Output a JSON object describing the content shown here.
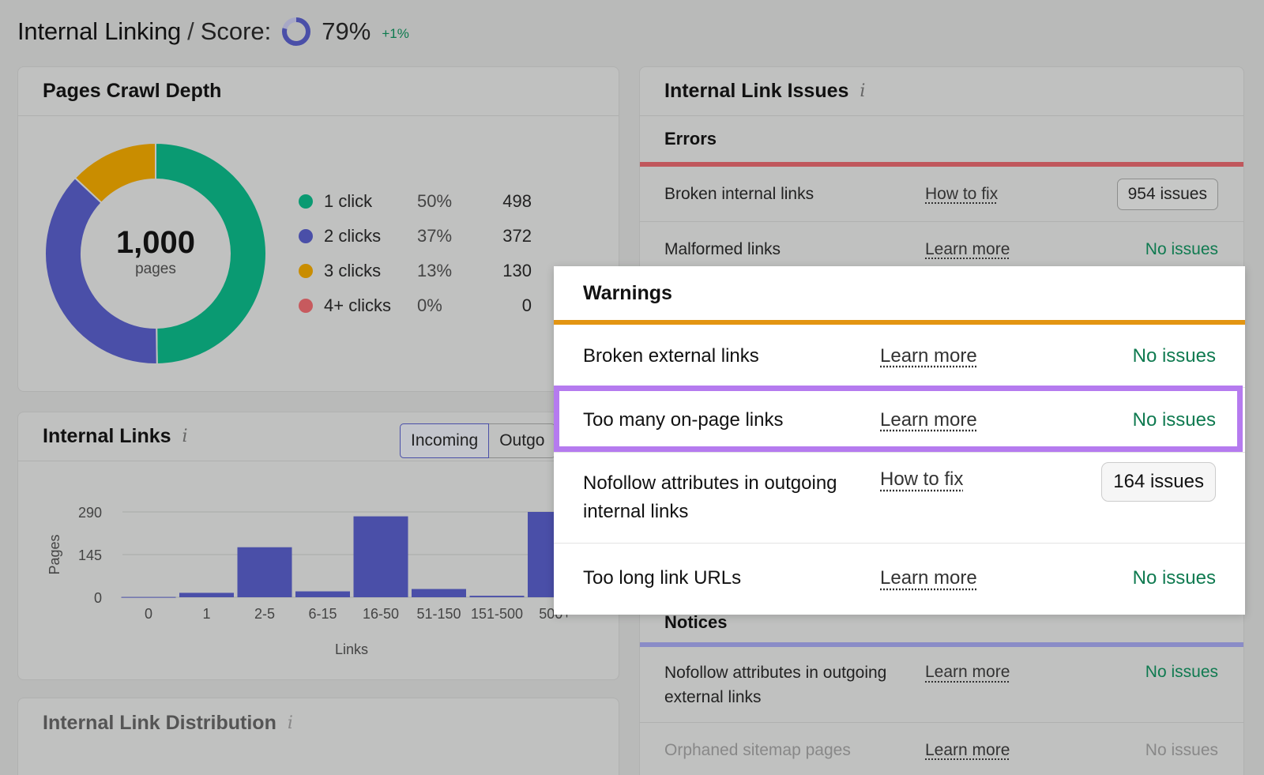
{
  "header": {
    "title": "Internal Linking",
    "separator": "/",
    "score_label": "Score:",
    "score_value": "79%",
    "score_delta": "+1%",
    "score_color": "#4a4fa8"
  },
  "crawl_depth": {
    "title": "Pages Crawl Depth",
    "total": "1,000",
    "total_label": "pages",
    "items": [
      {
        "label": "1 click",
        "pct": "50%",
        "value": "498",
        "color": "#0a9a72"
      },
      {
        "label": "2 clicks",
        "pct": "37%",
        "value": "372",
        "color": "#4a4fa8"
      },
      {
        "label": "3 clicks",
        "pct": "13%",
        "value": "130",
        "color": "#c98d00"
      },
      {
        "label": "4+ clicks",
        "pct": "0%",
        "value": "0",
        "color": "#c75a5e"
      }
    ]
  },
  "internal_links": {
    "title": "Internal Links",
    "tabs": [
      "Incoming",
      "Outgo"
    ]
  },
  "chart_data": {
    "type": "bar",
    "categories": [
      "0",
      "1",
      "2-5",
      "6-15",
      "16-50",
      "51-150",
      "151-500",
      "500+"
    ],
    "values": [
      1,
      15,
      170,
      20,
      275,
      28,
      5,
      290
    ],
    "xlabel": "Links",
    "ylabel": "Pages",
    "yticks": [
      "290",
      "145",
      "0"
    ],
    "ylim": [
      0,
      290
    ],
    "bar_color": "#4a4fa8",
    "grid": true
  },
  "distribution": {
    "title": "Internal Link Distribution"
  },
  "issues": {
    "title": "Internal Link Issues",
    "errors_label": "Errors",
    "errors": [
      {
        "name": "Broken internal links",
        "link": "How to fix",
        "status": "954 issues"
      },
      {
        "name": "Malformed links",
        "link": "Learn more",
        "status": "No issues"
      }
    ],
    "notices_label": "Notices",
    "notices": [
      {
        "name": "Nofollow attributes in outgoing external links",
        "link": "Learn more",
        "status": "No issues"
      },
      {
        "name": "Orphaned sitemap pages",
        "link": "Learn more",
        "status": "No issues"
      }
    ]
  },
  "warnings": {
    "title": "Warnings",
    "rows": [
      {
        "name": "Broken external links",
        "link": "Learn more",
        "status": "No issues"
      },
      {
        "name": "Too many on-page links",
        "link": "Learn more",
        "status": "No issues"
      },
      {
        "name": "Nofollow attributes in outgoing internal links",
        "link": "How to fix",
        "status": "164 issues"
      },
      {
        "name": "Too long link URLs",
        "link": "Learn more",
        "status": "No issues"
      }
    ]
  }
}
